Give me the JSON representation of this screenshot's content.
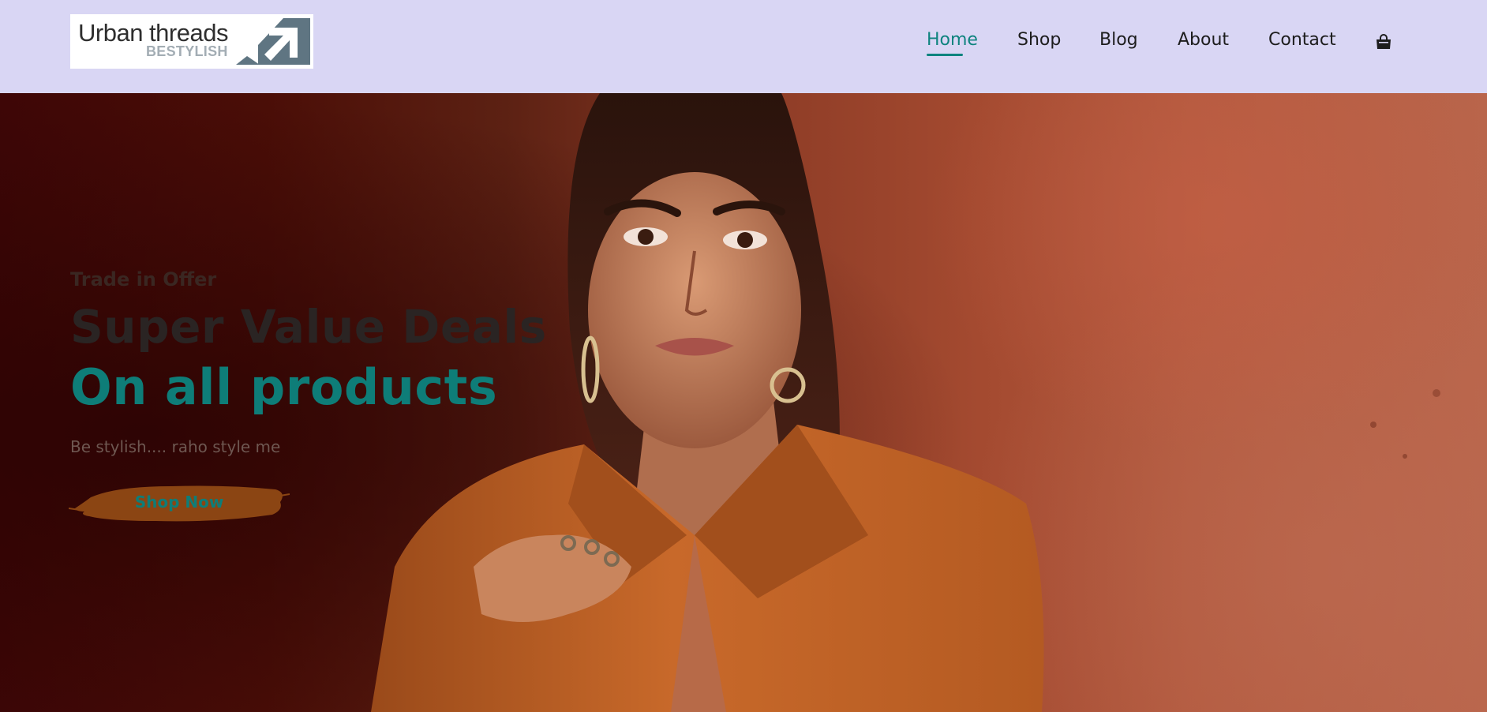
{
  "header": {
    "logo": {
      "title": "Urban threads",
      "subtitle": "BESTYLISH"
    },
    "nav": [
      {
        "label": "Home",
        "active": true
      },
      {
        "label": "Shop",
        "active": false
      },
      {
        "label": "Blog",
        "active": false
      },
      {
        "label": "About",
        "active": false
      },
      {
        "label": "Contact",
        "active": false
      }
    ],
    "cart_icon": "shopping-bag-icon"
  },
  "hero": {
    "kicker": "Trade in Offer",
    "headline": "Super Value Deals",
    "headline_accent": "On all products",
    "tagline": "Be stylish.... raho style me",
    "cta_label": "Shop Now"
  },
  "colors": {
    "header_bg": "#d9d6f4",
    "accent": "#0e837e",
    "cta_brush": "#8b4513"
  }
}
